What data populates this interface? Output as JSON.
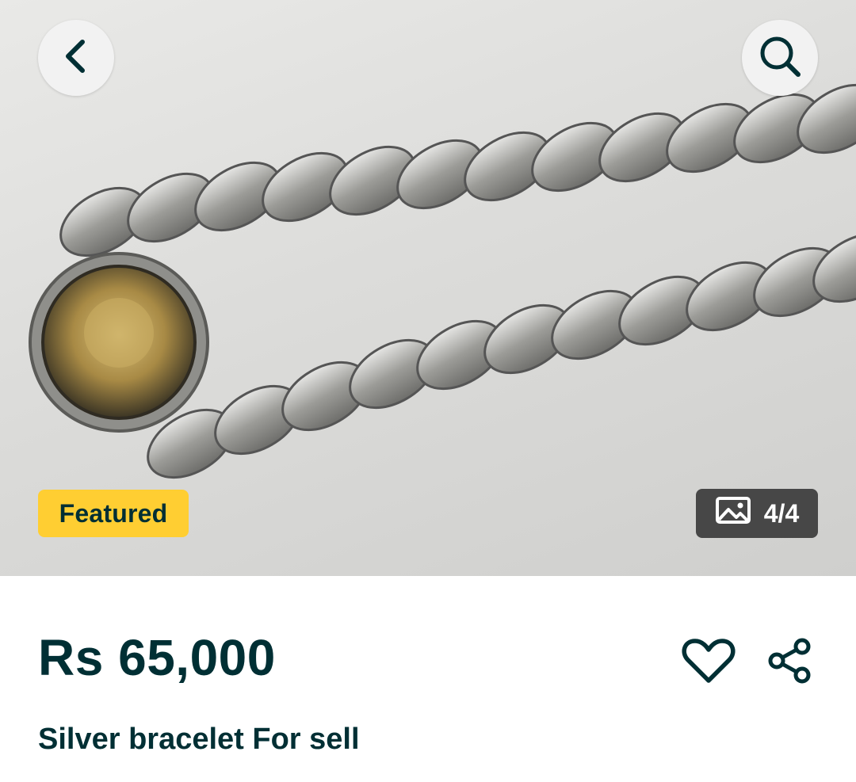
{
  "header": {
    "back_icon": "chevron-left-icon",
    "search_icon": "search-icon"
  },
  "gallery": {
    "badge_label": "Featured",
    "badge_color": "#ffce32",
    "counter_icon": "image-icon",
    "counter_text": "4/4"
  },
  "listing": {
    "price": "Rs 65,000",
    "title": "Silver bracelet For sell",
    "favorite_icon": "heart-icon",
    "share_icon": "share-icon"
  },
  "colors": {
    "text_primary": "#002f34",
    "badge": "#ffce32"
  }
}
